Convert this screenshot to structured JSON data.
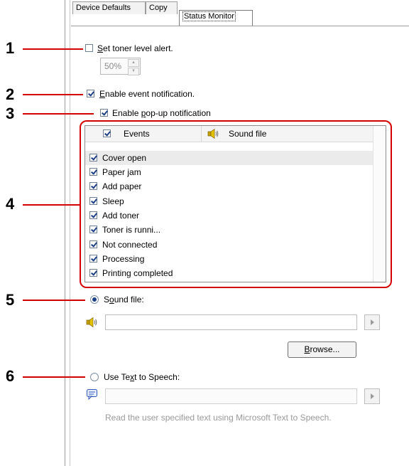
{
  "tabs": [
    {
      "label": "Device Defaults",
      "active": false
    },
    {
      "label": "Copy",
      "active": false
    },
    {
      "label": "Status Monitor",
      "active": true
    }
  ],
  "callouts": [
    "1",
    "2",
    "3",
    "4",
    "5",
    "6"
  ],
  "toner_alert": {
    "pre": "",
    "mnemonic": "S",
    "post": "et toner level alert.",
    "checked": false
  },
  "toner_level": {
    "value": "50%"
  },
  "event_notification": {
    "pre": "",
    "mnemonic": "E",
    "post": "nable event notification.",
    "checked": true
  },
  "popup_notification": {
    "pre": "Enable ",
    "mnemonic": "p",
    "post": "op-up notification",
    "checked": true
  },
  "event_list": {
    "col_events": "Events",
    "col_sound": "Sound file",
    "header_checked": true,
    "items": [
      {
        "label": "Cover open",
        "checked": true
      },
      {
        "label": "Paper jam",
        "checked": true
      },
      {
        "label": "Add paper",
        "checked": true
      },
      {
        "label": "Sleep",
        "checked": true
      },
      {
        "label": "Add toner",
        "checked": true
      },
      {
        "label": "Toner is runni...",
        "checked": true
      },
      {
        "label": "Not connected",
        "checked": true
      },
      {
        "label": "Processing",
        "checked": true
      },
      {
        "label": "Printing completed",
        "checked": true
      }
    ]
  },
  "sound_file": {
    "pre": "S",
    "mnemonic": "o",
    "post": "und file:",
    "selected": true,
    "value": ""
  },
  "browse": {
    "pre": "",
    "mnemonic": "B",
    "post": "rowse..."
  },
  "tts": {
    "pre": "Use Te",
    "mnemonic": "x",
    "post": "t to Speech:",
    "selected": false,
    "value": ""
  },
  "tts_hint": "Read the user specified text using Microsoft Text to Speech.",
  "colors": {
    "callout_line": "#d40000",
    "check": "#1c3f86"
  },
  "icons": [
    "speaker-icon",
    "speech-bubble-icon",
    "play-icon",
    "checkmark-icon"
  ]
}
